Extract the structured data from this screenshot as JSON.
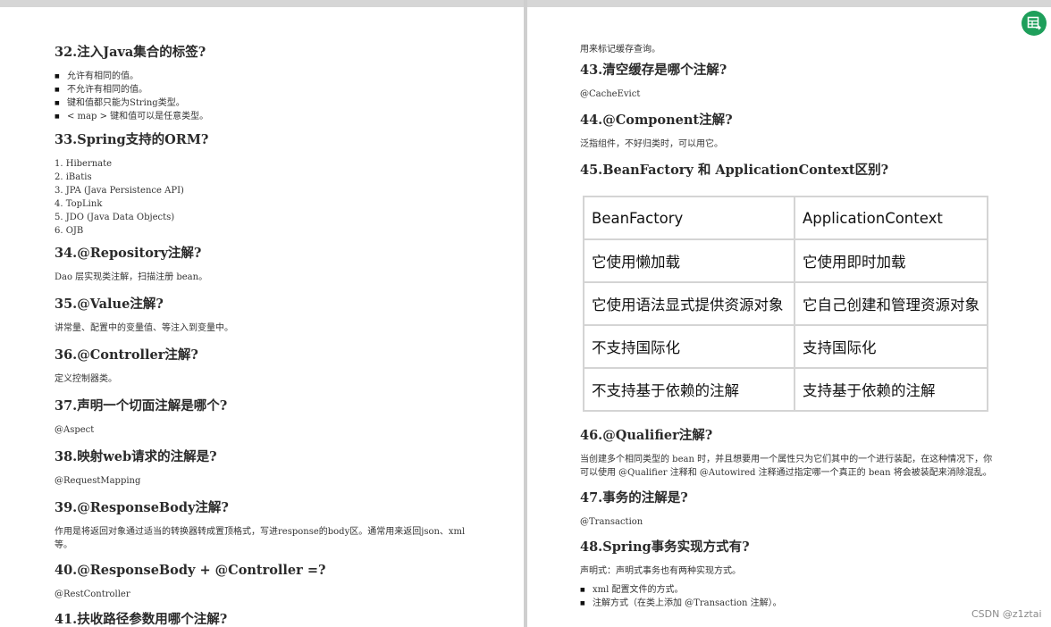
{
  "left": {
    "s32": {
      "num": "32.",
      "title": "注入Java集合的标签?",
      "items": [
        "允许有相同的值。",
        "不允许有相同的值。",
        "键和值都只能为String类型。",
        "< map >  键和值可以是任意类型。"
      ]
    },
    "s33": {
      "num": "33.",
      "title": "Spring支持的ORM?",
      "items": [
        "1. Hibernate",
        "2. iBatis",
        "3. JPA (Java Persistence API)",
        "4. TopLink",
        "5. JDO (Java Data Objects)",
        "6. OJB"
      ]
    },
    "s34": {
      "num": "34.",
      "title": "@Repository注解?",
      "text": "Dao 层实现类注解，扫描注册 bean。"
    },
    "s35": {
      "num": "35.",
      "title": "@Value注解?",
      "text": "讲常量、配置中的变量值、等注入到变量中。"
    },
    "s36": {
      "num": "36.",
      "title": "@Controller注解?",
      "text": "定义控制器类。"
    },
    "s37": {
      "num": "37.",
      "title": "声明一个切面注解是哪个?",
      "text": "@Aspect"
    },
    "s38": {
      "num": "38.",
      "title": "映射web请求的注解是?",
      "text": "@RequestMapping"
    },
    "s39": {
      "num": "39.",
      "title": "@ResponseBody注解?",
      "text": "作用是将返回对象通过适当的转换器转成置顶格式，写进response的body区。通常用来返回json、xml等。"
    },
    "s40": {
      "num": "40.",
      "title": "@ResponseBody + @Controller =?",
      "text": "@RestController"
    },
    "s41": {
      "num": "41.",
      "title": "扶收路径参数用哪个注解?"
    }
  },
  "right": {
    "lead": "用来标记缓存查询。",
    "s43": {
      "num": "43.",
      "title": "清空缓存是哪个注解?",
      "text": "@CacheEvict"
    },
    "s44": {
      "num": "44.",
      "title": "@Component注解?",
      "text": "泛指组件，不好归类时，可以用它。"
    },
    "s45": {
      "num": "45.",
      "title": "BeanFactory 和 ApplicationContext区别?"
    },
    "table": [
      [
        "BeanFactory",
        "ApplicationContext"
      ],
      [
        "它使用懒加载",
        "它使用即时加载"
      ],
      [
        "它使用语法显式提供资源对象",
        "它自己创建和管理资源对象"
      ],
      [
        "不支持国际化",
        "支持国际化"
      ],
      [
        "不支持基于依赖的注解",
        "支持基于依赖的注解"
      ]
    ],
    "s46": {
      "num": "46.",
      "title": "@Qualifier注解?",
      "text": "当创建多个相同类型的 bean 时，并且想要用一个属性只为它们其中的一个进行装配，在这种情况下，你可以使用 @Qualifier 注释和 @Autowired 注释通过指定哪一个真正的 bean 将会被装配来消除混乱。"
    },
    "s47": {
      "num": "47.",
      "title": "事务的注解是?",
      "text": "@Transaction"
    },
    "s48": {
      "num": "48.",
      "title": "Spring事务实现方式有?",
      "text": "声明式：声明式事务也有两种实现方式。",
      "items": [
        "xml 配置文件的方式。",
        "注解方式（在类上添加 @Transaction 注解）。"
      ]
    }
  },
  "watermark": "CSDN @z1ztai",
  "fab_icon": "export-table-icon",
  "colors": {
    "fab": "#1e9f5b",
    "table_border": "#d4d4d4"
  }
}
